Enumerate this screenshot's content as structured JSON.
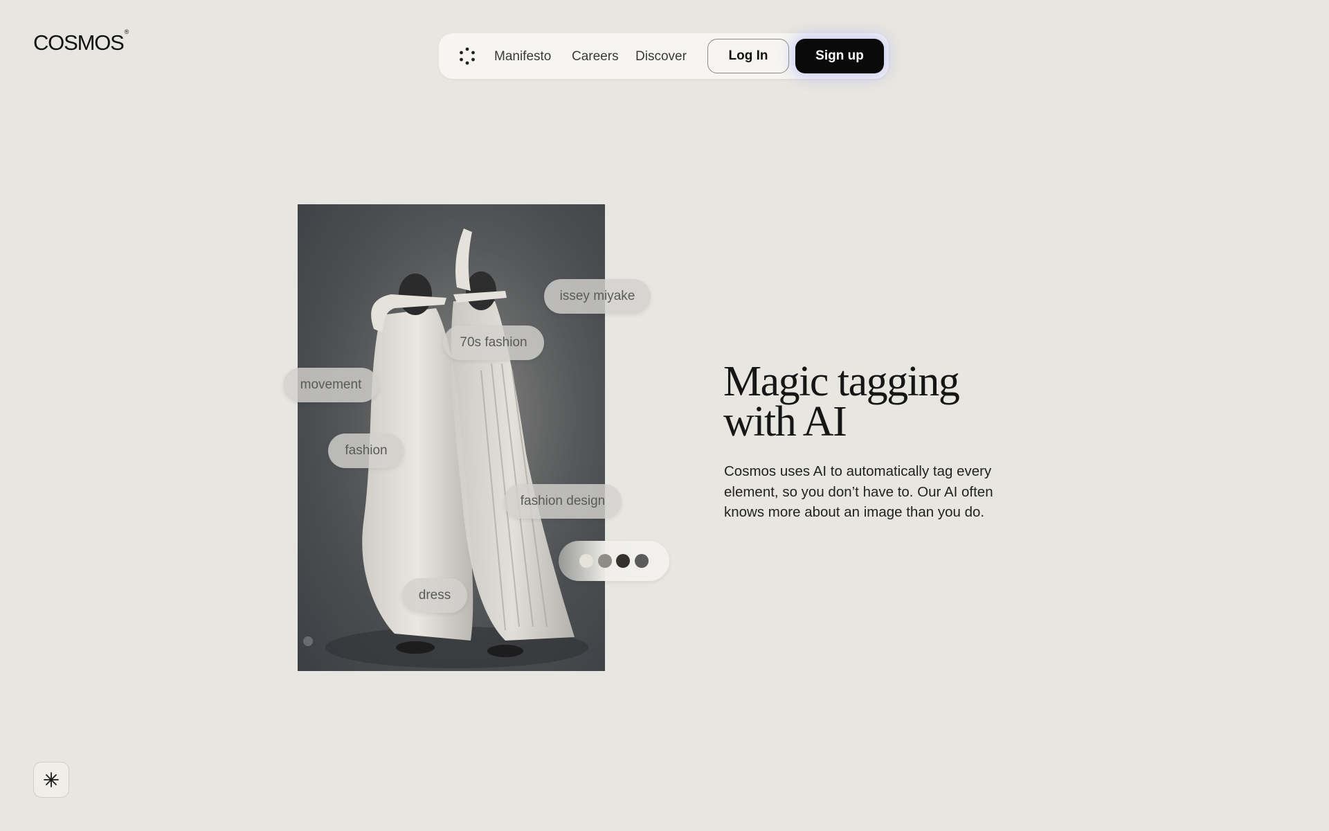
{
  "brand": {
    "name": "COSMOS",
    "mark": "®"
  },
  "nav": {
    "links": [
      "Manifesto",
      "Careers",
      "Discover"
    ],
    "login_label": "Log In",
    "signup_label": "Sign up"
  },
  "icons": {
    "nav": "dots-circle-icon",
    "corner": "sparkle-icon"
  },
  "feature": {
    "tags": [
      "issey miyake",
      "70s fashion",
      "movement",
      "fashion",
      "fashion design",
      "dress"
    ],
    "palette": [
      "#e6e3da",
      "#8f8c86",
      "#35312f",
      "#5b5b5b"
    ],
    "headline": "Magic tagging with AI",
    "body": "Cosmos uses AI to automatically tag every element, so you don’t have to. Our AI often knows more about an image than you do."
  },
  "colors": {
    "background": "#e8e6e0",
    "signup_bg": "#0a0a0a",
    "signup_glow": "#8c96ff"
  }
}
